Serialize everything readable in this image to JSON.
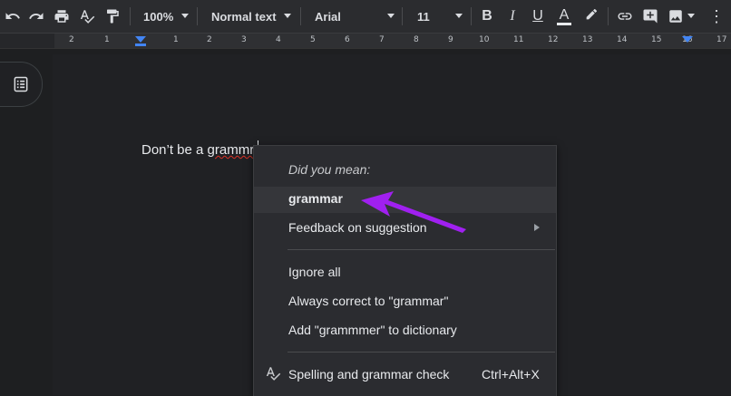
{
  "toolbar": {
    "zoom": "100%",
    "style": "Normal text",
    "font": "Arial",
    "size": "11",
    "icons": [
      "undo-icon",
      "redo-icon",
      "print-icon",
      "spellcheck-icon",
      "paint-format-icon",
      "bold-icon",
      "italic-icon",
      "underline-icon",
      "text-color-icon",
      "highlight-icon",
      "link-icon",
      "add-comment-icon",
      "image-icon"
    ],
    "glyphs": {
      "bold": "B",
      "italic": "I",
      "underline": "U",
      "text_color": "A"
    }
  },
  "ruler": {
    "ticks": [
      "2",
      "1",
      "1",
      "2",
      "3",
      "4",
      "5",
      "6",
      "7",
      "8",
      "9",
      "10",
      "11",
      "12",
      "13",
      "14",
      "15",
      "16",
      "17"
    ]
  },
  "document": {
    "text_before": "Don’t be a ",
    "misspelled": "grammr",
    "accent_color": "#4285f4"
  },
  "context_menu": {
    "heading": "Did you mean:",
    "suggestion": "grammar",
    "feedback": "Feedback on suggestion",
    "ignore_all": "Ignore all",
    "always_correct": "Always correct to \"grammar\"",
    "add_to_dictionary": "Add \"grammmer\" to dictionary",
    "spell_check": "Spelling and grammar check",
    "spell_check_shortcut": "Ctrl+Alt+X"
  },
  "annotation": {
    "arrow_color": "#a020f0"
  }
}
